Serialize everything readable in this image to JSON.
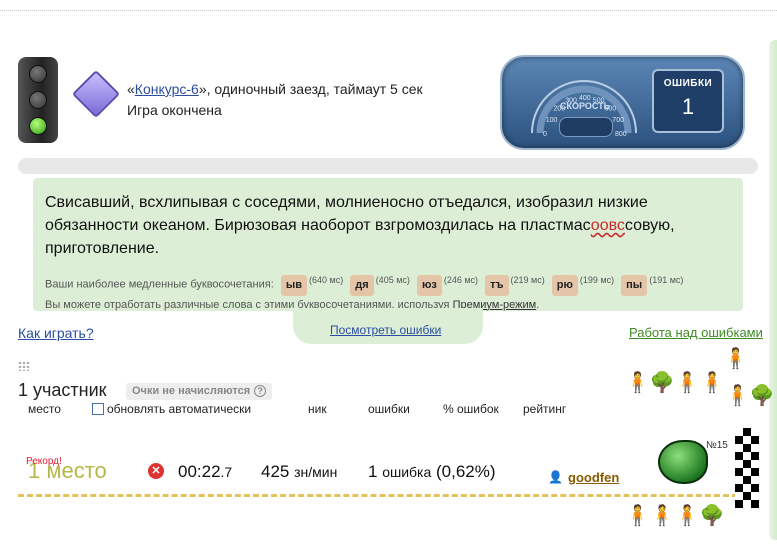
{
  "race": {
    "quote_open": "«",
    "contest_link": "Конкурс-6",
    "details": "», одиночный заезд, таймаут 5 сек",
    "status": "Игра окончена"
  },
  "panel": {
    "speed_label": "СКОРОСТЬ",
    "errors_label": "ОШИБКИ",
    "errors_value": "1",
    "dial_ticks": [
      "0",
      "100",
      "200",
      "300",
      "400",
      "500",
      "600",
      "700",
      "800"
    ]
  },
  "text": {
    "before": "Свисавший, всхлипывая с соседями, молниеносно отъедался, изобразил низкие обязанности океаном. Бирюзовая наоборот взгромоздилась на пластмас",
    "error": "оовс",
    "after": "совую, приготовление."
  },
  "slow": {
    "label": "Ваши наиболее медленные буквосочетания:",
    "combos": [
      {
        "s": "ыв",
        "t": "(640 мс)"
      },
      {
        "s": "дя",
        "t": "(405 мс)"
      },
      {
        "s": "юз",
        "t": "(246 мс)"
      },
      {
        "s": "тъ",
        "t": "(219 мс)"
      },
      {
        "s": "рю",
        "t": "(199 мс)"
      },
      {
        "s": "пы",
        "t": "(191 мс)"
      }
    ],
    "practice_text": "Вы можете отработать различные слова с этими буквосочетаниями, используя ",
    "premium_link": "Премиум-режим",
    "practice_end": "."
  },
  "links": {
    "how_to_play": "Как играть?",
    "see_errors": "Посмотреть ошибки",
    "work_on_errors": "Работа над ошибками"
  },
  "table": {
    "participants": "1 участник",
    "no_count": "Очки не начисляются",
    "help": "?",
    "headers": {
      "place": "место",
      "auto_update": "обновлять автоматически",
      "nick": "ник",
      "errors": "ошибки",
      "error_pct": "% ошибок",
      "rating": "рейтинг"
    }
  },
  "result": {
    "record": "Рекорд!",
    "place": "1 место",
    "time_main": "00:22",
    "time_frac": ".7",
    "speed": "425",
    "speed_unit": "зн/мин",
    "errors_count": "1",
    "errors_word": "ошибка",
    "errors_pct": "(0,62%)",
    "nick": "goodfen",
    "car_number": "№15"
  },
  "colors": {
    "text_box_bg": "#dcefd6",
    "link_blue": "#2a4d9f",
    "link_green": "#3e8a23",
    "error_red": "#c92a2a"
  }
}
